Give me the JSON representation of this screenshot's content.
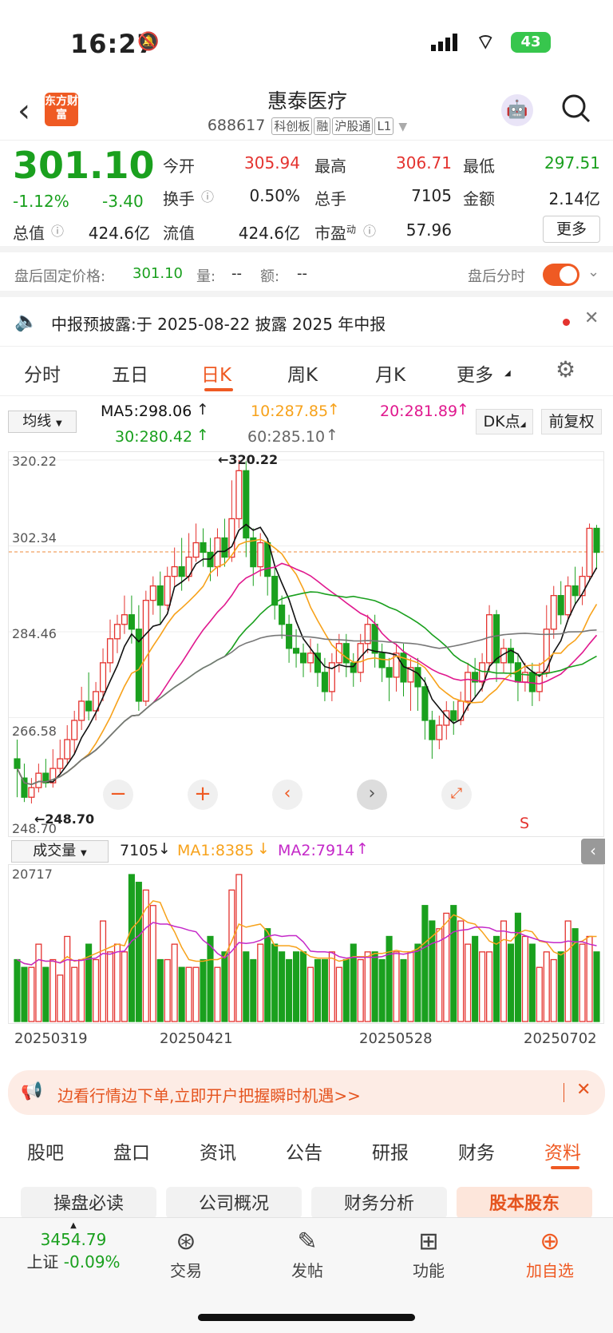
{
  "status": {
    "time": "16:27",
    "battery": "43"
  },
  "header": {
    "back_icon": "back-arrow-icon",
    "broker_logo": "东方财富",
    "title": "惠泰医疗",
    "code": "688617",
    "tags": [
      "科创板",
      "融",
      "沪股通",
      "L1"
    ],
    "avatar_icon": "robot-avatar-icon",
    "search_icon": "search-icon"
  },
  "quote": {
    "price": "301.10",
    "pct": "-1.12%",
    "chg": "-3.40",
    "open_label": "今开",
    "open": "305.94",
    "high_label": "最高",
    "high": "306.71",
    "low_label": "最低",
    "low": "297.51",
    "turnover_label": "换手",
    "turnover": "0.50%",
    "vol_label": "总手",
    "vol": "7105",
    "amount_label": "金额",
    "amount": "2.14亿",
    "mcap_label": "总值",
    "mcap": "424.6亿",
    "float_label": "流值",
    "float": "424.6亿",
    "pe_label": "市盈",
    "pe_sup": "动",
    "pe": "57.96",
    "more": "更多"
  },
  "after": {
    "label": "盘后固定价格:",
    "price": "301.10",
    "vol_label": "量:",
    "vol": "--",
    "amt_label": "额:",
    "amt": "--",
    "timeline": "盘后分时"
  },
  "notice": {
    "text": "中报预披露:于 2025-08-22 披露 2025 年中报"
  },
  "tabs": [
    "分时",
    "五日",
    "日K",
    "周K",
    "月K",
    "更多"
  ],
  "ma": {
    "type": "均线",
    "ma5": "MA5:298.06",
    "ma10": "10:287.85",
    "ma20": "20:281.89",
    "ma30": "30:280.42",
    "ma60": "60:285.10",
    "dk": "DK点",
    "fq": "前复权"
  },
  "kchart": {
    "ticks": [
      "320.22",
      "302.34",
      "284.46",
      "266.58",
      "248.70"
    ],
    "max_label": "320.22",
    "min_label": "248.70",
    "s_label": "S"
  },
  "vol": {
    "type": "成交量",
    "value": "7105",
    "ma1": "MA1:8385",
    "ma2": "MA2:7914",
    "top": "20717"
  },
  "dates": [
    "20250319",
    "20250421",
    "20250528",
    "20250702"
  ],
  "banner": {
    "text": "边看行情边下单,立即开户把握瞬时机遇>>"
  },
  "subtabs": [
    "股吧",
    "盘口",
    "资讯",
    "公告",
    "研报",
    "财务",
    "资料"
  ],
  "buttons": [
    "操盘必读",
    "公司概况",
    "财务分析",
    "股本股东"
  ],
  "bottom": {
    "index_value": "3454.79",
    "index_name": "上证",
    "index_pct": "-0.09%",
    "items": [
      "交易",
      "发帖",
      "功能",
      "加自选"
    ]
  },
  "colors": {
    "up": "#e4332f",
    "down": "#1aa01e",
    "accent": "#ef5a23",
    "ma5": "#111111",
    "ma10": "#f7a21b",
    "ma20": "#e0188e",
    "ma30": "#1aa01e",
    "ma60": "#777777"
  },
  "chart_data": {
    "type": "candlestick",
    "ylim": [
      248.7,
      320.22
    ],
    "high_annot": 320.22,
    "low_annot": 248.7,
    "candles": [
      [
        258,
        256,
        262,
        250
      ],
      [
        254,
        250,
        257,
        249
      ],
      [
        250,
        252,
        254,
        248.7
      ],
      [
        252,
        255,
        257,
        251
      ],
      [
        255,
        253,
        258,
        252
      ],
      [
        253,
        256,
        260,
        252
      ],
      [
        256,
        258,
        262,
        255
      ],
      [
        258,
        262,
        265,
        257
      ],
      [
        262,
        266,
        268,
        259
      ],
      [
        266,
        270,
        273,
        264
      ],
      [
        270,
        268,
        276,
        266
      ],
      [
        268,
        272,
        274,
        266
      ],
      [
        272,
        278,
        281,
        270
      ],
      [
        278,
        283,
        287,
        276
      ],
      [
        283,
        286,
        288,
        280
      ],
      [
        286,
        288,
        292,
        284
      ],
      [
        288,
        285,
        292,
        282
      ],
      [
        285,
        270,
        290,
        268
      ],
      [
        270,
        291,
        293,
        269
      ],
      [
        291,
        294,
        296,
        288
      ],
      [
        294,
        290,
        297,
        286
      ],
      [
        290,
        296,
        298,
        289
      ],
      [
        296,
        298,
        302,
        294
      ],
      [
        298,
        296,
        304,
        293
      ],
      [
        296,
        300,
        305,
        295
      ],
      [
        300,
        303,
        307,
        299
      ],
      [
        303,
        301,
        306,
        298
      ],
      [
        301,
        298,
        304,
        295
      ],
      [
        298,
        304,
        306,
        296
      ],
      [
        304,
        300,
        308,
        298
      ],
      [
        300,
        308,
        316,
        299
      ],
      [
        308,
        318,
        320.22,
        306
      ],
      [
        318,
        304,
        320,
        300
      ],
      [
        304,
        298,
        306,
        294
      ],
      [
        298,
        303,
        305,
        296
      ],
      [
        303,
        296,
        304,
        292
      ],
      [
        296,
        290,
        298,
        287
      ],
      [
        290,
        286,
        292,
        283
      ],
      [
        286,
        281,
        288,
        278
      ],
      [
        281,
        280,
        285,
        277
      ],
      [
        280,
        278,
        282,
        275
      ],
      [
        278,
        280,
        283,
        276
      ],
      [
        280,
        276,
        282,
        273
      ],
      [
        276,
        272,
        279,
        270
      ],
      [
        272,
        278,
        280,
        270
      ],
      [
        278,
        282,
        284,
        276
      ],
      [
        282,
        278,
        284,
        275
      ],
      [
        278,
        276,
        280,
        273
      ],
      [
        276,
        282,
        284,
        274
      ],
      [
        282,
        286,
        288,
        280
      ],
      [
        286,
        280,
        288,
        277
      ],
      [
        280,
        277,
        282,
        274
      ],
      [
        277,
        275,
        279,
        270
      ],
      [
        275,
        280,
        282,
        272
      ],
      [
        280,
        274,
        282,
        271
      ],
      [
        274,
        277,
        279,
        268
      ],
      [
        277,
        273,
        279,
        268
      ],
      [
        273,
        266,
        275,
        262
      ],
      [
        266,
        262,
        268,
        258
      ],
      [
        262,
        265,
        267,
        260
      ],
      [
        265,
        268,
        270,
        262
      ],
      [
        268,
        266,
        270,
        263
      ],
      [
        266,
        270,
        272,
        265
      ],
      [
        270,
        276,
        278,
        268
      ],
      [
        276,
        274,
        279,
        271
      ],
      [
        274,
        278,
        280,
        272
      ],
      [
        278,
        288,
        290,
        276
      ],
      [
        288,
        278,
        289,
        274
      ],
      [
        278,
        281,
        283,
        276
      ],
      [
        281,
        278,
        283,
        275
      ],
      [
        278,
        274,
        280,
        270
      ],
      [
        274,
        276,
        278,
        272
      ],
      [
        276,
        272,
        278,
        269
      ],
      [
        272,
        276,
        278,
        270
      ],
      [
        276,
        285,
        290,
        275
      ],
      [
        285,
        292,
        294,
        283
      ],
      [
        292,
        288,
        295,
        286
      ],
      [
        288,
        294,
        296,
        287
      ],
      [
        294,
        292,
        298,
        290
      ],
      [
        292,
        296,
        298,
        290
      ],
      [
        296,
        306,
        307,
        295
      ],
      [
        306,
        301,
        306.71,
        297.51
      ]
    ],
    "volume": [
      8,
      7,
      7,
      10,
      7,
      8,
      6,
      11,
      7,
      8,
      10,
      8,
      13,
      9,
      10,
      9,
      19,
      18,
      17,
      15,
      8,
      8,
      10,
      7,
      7,
      7,
      8,
      11,
      7,
      9,
      17,
      19,
      9,
      8,
      10,
      12,
      10,
      9,
      8,
      9,
      9,
      7,
      8,
      8,
      9,
      7,
      8,
      10,
      8,
      9,
      9,
      8,
      11,
      9,
      8,
      9,
      10,
      15,
      13,
      12,
      14,
      15,
      13,
      10,
      11,
      9,
      9,
      11,
      13,
      10,
      14,
      11,
      10,
      7,
      9,
      8,
      9,
      13,
      12,
      10,
      11,
      9
    ]
  }
}
